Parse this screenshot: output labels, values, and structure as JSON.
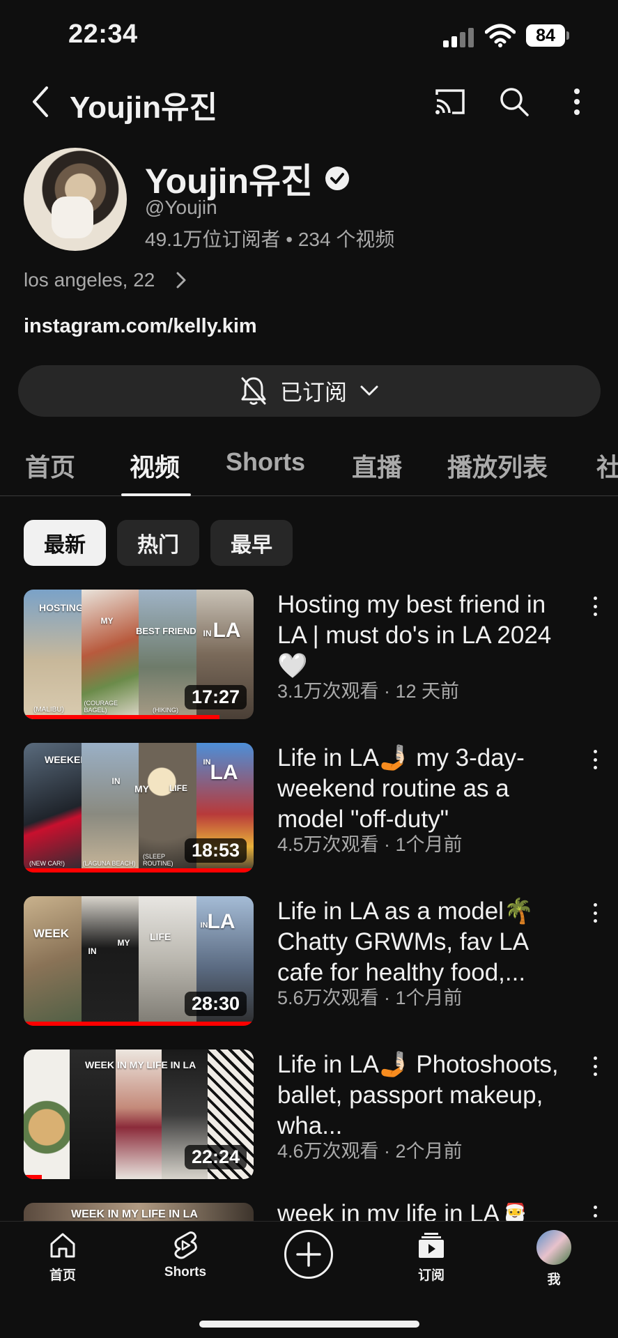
{
  "status_bar": {
    "time": "22:34",
    "battery": "84"
  },
  "top_bar": {
    "title": "Youjin유진",
    "icons": [
      "back-icon",
      "cast-icon",
      "search-icon",
      "more-vert-icon"
    ]
  },
  "channel": {
    "name": "Youjin유진",
    "handle": "@Youjin",
    "stats": "49.1万位订阅者 • 234 个视频",
    "description": "los angeles, 22",
    "link": "instagram.com/kelly.kim",
    "subscribe_label": "已订阅"
  },
  "tabs": [
    "首页",
    "视频",
    "Shorts",
    "直播",
    "播放列表",
    "社"
  ],
  "active_tab": "视频",
  "chips": [
    "最新",
    "热门",
    "最早"
  ],
  "videos": [
    {
      "title": "Hosting my best friend in LA | must do's in LA 2024🤍",
      "meta": "3.1万次观看 · 12 天前",
      "duration": "17:27",
      "progress": 0.85,
      "thumb_texts": [
        "HOSTING",
        "MY",
        "BEST FRIEND",
        "IN",
        "LA"
      ],
      "thumb_captions": [
        "(MALIBU)",
        "(COURAGE BAGEL)",
        "(HIKING)"
      ]
    },
    {
      "title": "Life in LA🤳🏻 my 3-day-weekend routine as a model \"off-duty\"",
      "meta": "4.5万次观看 · 1个月前",
      "duration": "18:53",
      "progress": 1.0,
      "thumb_texts": [
        "WEEKEND",
        "IN",
        "MY",
        "LIFE",
        "IN",
        "LA"
      ],
      "thumb_captions": [
        "(NEW CAR!)",
        "(LAGUNA BEACH)",
        "(SLEEP ROUTINE)"
      ]
    },
    {
      "title": "Life in LA as a model🌴 Chatty GRWMs, fav LA cafe for healthy food,...",
      "meta": "5.6万次观看 · 1个月前",
      "duration": "28:30",
      "progress": 1.0,
      "thumb_texts": [
        "WEEK",
        "IN",
        "MY",
        "LIFE",
        "IN",
        "LA"
      ],
      "thumb_captions": []
    },
    {
      "title": "Life in LA🤳🏻 Photoshoots, ballet, passport makeup, wha...",
      "meta": "4.6万次观看 · 2个月前",
      "duration": "22:24",
      "progress": 0.08,
      "thumb_texts": [
        "WEEK IN MY LIFE IN LA"
      ],
      "thumb_captions": []
    },
    {
      "title": "week in my life in LA🎅",
      "meta": "",
      "duration": "",
      "progress": 0,
      "thumb_texts": [
        "WEEK IN MY LIFE IN LA"
      ],
      "thumb_captions": []
    }
  ],
  "bottom_nav": [
    {
      "label": "首页",
      "icon": "home-icon"
    },
    {
      "label": "Shorts",
      "icon": "shorts-icon"
    },
    {
      "label": "",
      "icon": "create-icon"
    },
    {
      "label": "订阅",
      "icon": "subscriptions-icon"
    },
    {
      "label": "我",
      "icon": "avatar"
    }
  ]
}
